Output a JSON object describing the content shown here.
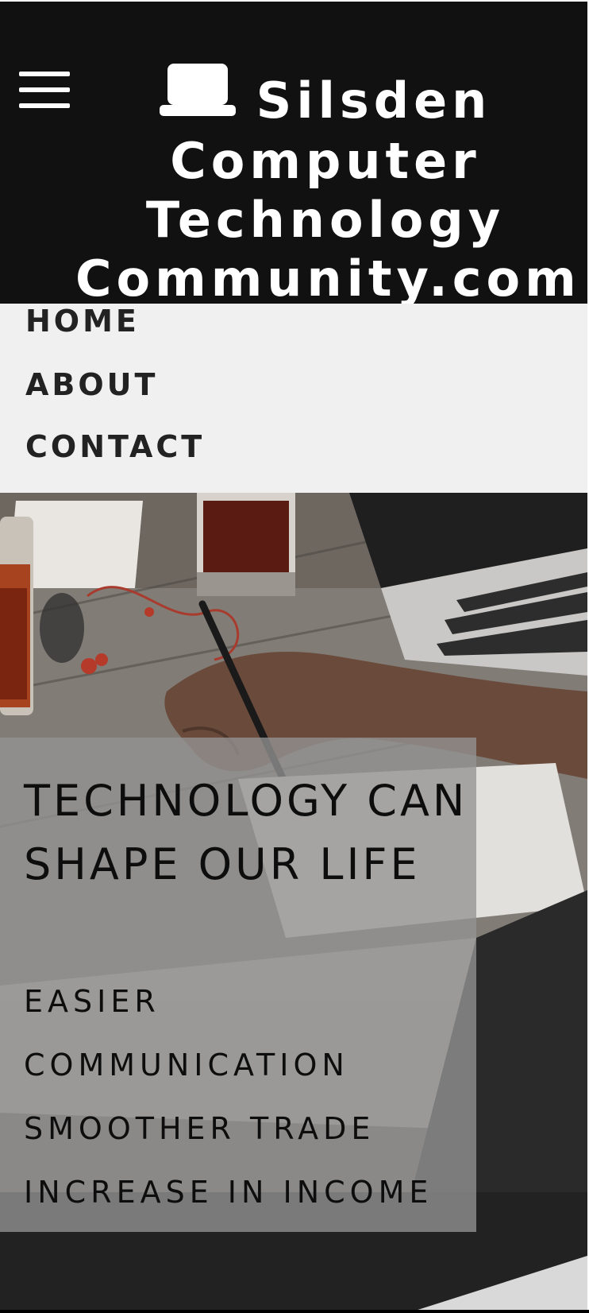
{
  "header": {
    "site_title": "Silsden Computer Technology Community.com",
    "menu_icon": "hamburger-menu-icon",
    "logo_icon": "laptop-icon",
    "background_color": "#111111"
  },
  "nav": {
    "items": [
      {
        "label": "HOME"
      },
      {
        "label": "ABOUT"
      },
      {
        "label": "CONTACT"
      }
    ],
    "background_color": "#f0f0f0"
  },
  "hero": {
    "title": "TECHNOLOGY CAN SHAPE OUR LIFE",
    "points": [
      "EASIER",
      "COMMUNICATION",
      "SMOOTHER TRADE",
      "INCREASE IN INCOME"
    ],
    "background_image": "desk-with-laptop-and-hand-writing-photo"
  }
}
